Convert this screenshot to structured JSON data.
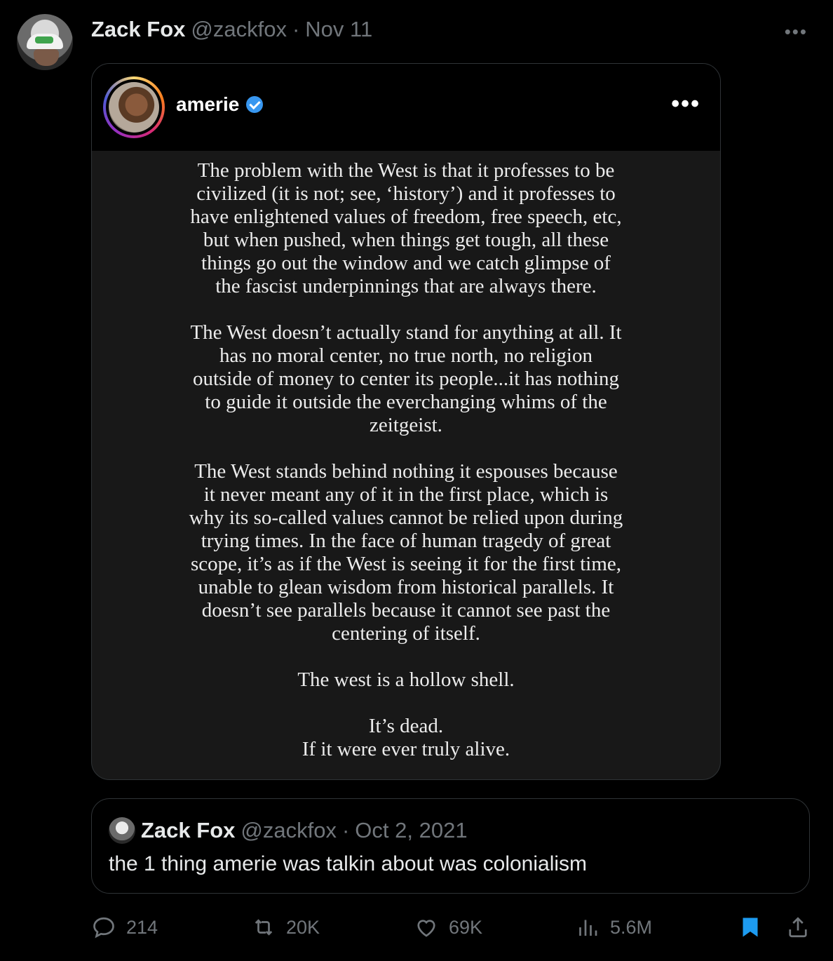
{
  "tweet": {
    "author_name": "Zack Fox",
    "author_handle": "@zackfox",
    "separator": "·",
    "date": "Nov 11",
    "more": "•••"
  },
  "ig_post": {
    "username": "amerie",
    "more": "•••",
    "paragraphs": [
      "The problem with the West is that it professes to be\ncivilized (it is not; see, ‘history’) and it professes to\nhave enlightened values of freedom, free speech, etc,\nbut when pushed, when things get tough, all these\nthings go out the window and we catch glimpse of\nthe fascist underpinnings that are always there.",
      "The West doesn’t actually stand for anything at all. It\nhas no moral center, no true north, no religion\noutside of money to center its people...it has nothing\nto guide it outside the everchanging whims of the\nzeitgeist.",
      "The West stands behind nothing it espouses because\nit never meant any of it in the first place, which is\nwhy its so-called values cannot be relied upon during\ntrying times. In the face of human tragedy of great\nscope, it’s as if the West is seeing it for the first time,\nunable to glean wisdom from historical parallels. It\ndoesn’t see parallels because it cannot see past the\ncentering of itself.",
      "The west is a hollow shell.",
      "It’s dead.\nIf it were ever truly alive."
    ]
  },
  "quoted": {
    "author_name": "Zack Fox",
    "author_handle": "@zackfox",
    "separator": "·",
    "date": "Oct 2, 2021",
    "text": "the 1 thing amerie was talkin about was colonialism"
  },
  "actions": {
    "replies": "214",
    "retweets": "20K",
    "likes": "69K",
    "views": "5.6M"
  },
  "colors": {
    "background": "#000000",
    "muted": "#71767b",
    "bookmark_active": "#1d9bf0",
    "verified": "#3897f0"
  }
}
